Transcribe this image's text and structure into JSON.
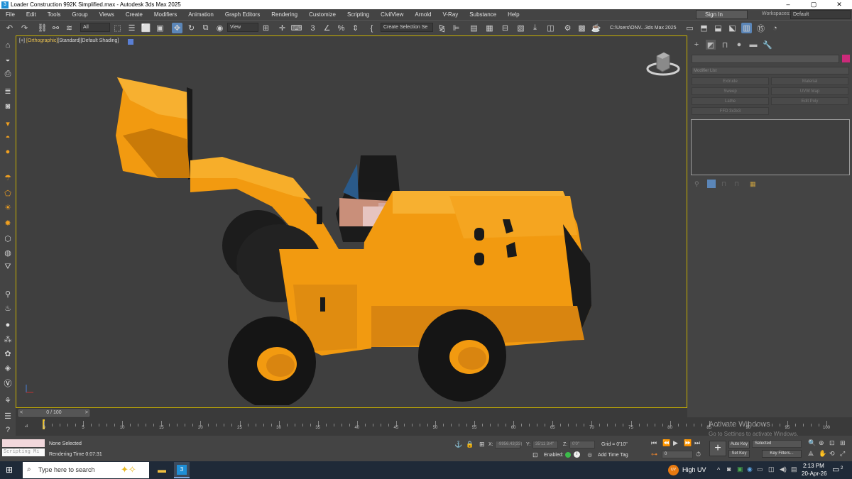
{
  "window": {
    "title": "Loader Construction 992K Simplified.max - Autodesk 3ds Max 2025",
    "controls": [
      "–",
      "▢",
      "✕"
    ]
  },
  "menu": [
    "File",
    "Edit",
    "Tools",
    "Group",
    "Views",
    "Create",
    "Modifiers",
    "Animation",
    "Graph Editors",
    "Rendering",
    "Customize",
    "Scripting",
    "CivilView",
    "Arnold",
    "V-Ray",
    "Substance",
    "Help"
  ],
  "signin": "Sign In",
  "workspaces": {
    "label": "Workspaces:",
    "value": "Default"
  },
  "toolbar": {
    "filter_value": "All",
    "view_value": "View",
    "selection_set_placeholder": "Create Selection Se",
    "project_path": "C:\\Users\\ONV...3ds Max 2025"
  },
  "viewport": {
    "label_plus": "[+]",
    "label_view": "[Orthographic]",
    "label_standard": "[Standard]",
    "label_shading": "[Default Shading]",
    "swatch_color": "#5a7fd4"
  },
  "command_panel": {
    "modifier_list_placeholder": "Modifier List",
    "modifier_buttons": [
      "Extrude",
      "Material",
      "Sweep",
      "UVW Map",
      "Lathe",
      "Edit Poly",
      "FFD 3x3x3"
    ],
    "object_color": "#cc2a7a"
  },
  "timeline": {
    "frame_display": "0 / 100",
    "tick_labels": [
      "0",
      "5",
      "10",
      "15",
      "20",
      "25",
      "30",
      "35",
      "40",
      "45",
      "50",
      "55",
      "60",
      "65",
      "70",
      "75",
      "80",
      "85",
      "90",
      "95",
      "100"
    ]
  },
  "status": {
    "script_label": "Scripting Mi",
    "selection": "None Selected",
    "render_time": "Rendering Time  0:07:31",
    "x_label": "X:",
    "x_value": "-9956.43(33)",
    "y_label": "Y:",
    "y_value": "35'11 3/4\"",
    "z_label": "Z:",
    "z_value": "0'0\"",
    "grid": "Grid = 0'10\"",
    "enabled_label": "Enabled:",
    "add_time_tag": "Add Time Tag",
    "auto_key": "Auto Key",
    "set_key": "Set Key",
    "selected_value": "Selected",
    "key_filters": "Key Filters...",
    "frame_value": "0"
  },
  "activate_windows": {
    "line1": "Activate Windows",
    "line2": "Go to Settings to activate Windows."
  },
  "taskbar": {
    "search_placeholder": "Type here to search",
    "weather": "High UV",
    "time": "2:13 PM",
    "date": "20-Apr-26",
    "notification_count": "2"
  }
}
